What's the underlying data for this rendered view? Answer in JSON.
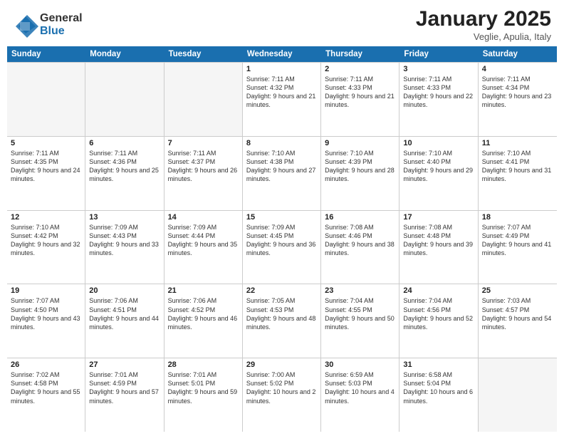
{
  "header": {
    "logo_general": "General",
    "logo_blue": "Blue",
    "month_title": "January 2025",
    "location": "Veglie, Apulia, Italy"
  },
  "weekdays": [
    "Sunday",
    "Monday",
    "Tuesday",
    "Wednesday",
    "Thursday",
    "Friday",
    "Saturday"
  ],
  "weeks": [
    [
      {
        "day": "",
        "info": ""
      },
      {
        "day": "",
        "info": ""
      },
      {
        "day": "",
        "info": ""
      },
      {
        "day": "1",
        "info": "Sunrise: 7:11 AM\nSunset: 4:32 PM\nDaylight: 9 hours and 21 minutes."
      },
      {
        "day": "2",
        "info": "Sunrise: 7:11 AM\nSunset: 4:33 PM\nDaylight: 9 hours and 21 minutes."
      },
      {
        "day": "3",
        "info": "Sunrise: 7:11 AM\nSunset: 4:33 PM\nDaylight: 9 hours and 22 minutes."
      },
      {
        "day": "4",
        "info": "Sunrise: 7:11 AM\nSunset: 4:34 PM\nDaylight: 9 hours and 23 minutes."
      }
    ],
    [
      {
        "day": "5",
        "info": "Sunrise: 7:11 AM\nSunset: 4:35 PM\nDaylight: 9 hours and 24 minutes."
      },
      {
        "day": "6",
        "info": "Sunrise: 7:11 AM\nSunset: 4:36 PM\nDaylight: 9 hours and 25 minutes."
      },
      {
        "day": "7",
        "info": "Sunrise: 7:11 AM\nSunset: 4:37 PM\nDaylight: 9 hours and 26 minutes."
      },
      {
        "day": "8",
        "info": "Sunrise: 7:10 AM\nSunset: 4:38 PM\nDaylight: 9 hours and 27 minutes."
      },
      {
        "day": "9",
        "info": "Sunrise: 7:10 AM\nSunset: 4:39 PM\nDaylight: 9 hours and 28 minutes."
      },
      {
        "day": "10",
        "info": "Sunrise: 7:10 AM\nSunset: 4:40 PM\nDaylight: 9 hours and 29 minutes."
      },
      {
        "day": "11",
        "info": "Sunrise: 7:10 AM\nSunset: 4:41 PM\nDaylight: 9 hours and 31 minutes."
      }
    ],
    [
      {
        "day": "12",
        "info": "Sunrise: 7:10 AM\nSunset: 4:42 PM\nDaylight: 9 hours and 32 minutes."
      },
      {
        "day": "13",
        "info": "Sunrise: 7:09 AM\nSunset: 4:43 PM\nDaylight: 9 hours and 33 minutes."
      },
      {
        "day": "14",
        "info": "Sunrise: 7:09 AM\nSunset: 4:44 PM\nDaylight: 9 hours and 35 minutes."
      },
      {
        "day": "15",
        "info": "Sunrise: 7:09 AM\nSunset: 4:45 PM\nDaylight: 9 hours and 36 minutes."
      },
      {
        "day": "16",
        "info": "Sunrise: 7:08 AM\nSunset: 4:46 PM\nDaylight: 9 hours and 38 minutes."
      },
      {
        "day": "17",
        "info": "Sunrise: 7:08 AM\nSunset: 4:48 PM\nDaylight: 9 hours and 39 minutes."
      },
      {
        "day": "18",
        "info": "Sunrise: 7:07 AM\nSunset: 4:49 PM\nDaylight: 9 hours and 41 minutes."
      }
    ],
    [
      {
        "day": "19",
        "info": "Sunrise: 7:07 AM\nSunset: 4:50 PM\nDaylight: 9 hours and 43 minutes."
      },
      {
        "day": "20",
        "info": "Sunrise: 7:06 AM\nSunset: 4:51 PM\nDaylight: 9 hours and 44 minutes."
      },
      {
        "day": "21",
        "info": "Sunrise: 7:06 AM\nSunset: 4:52 PM\nDaylight: 9 hours and 46 minutes."
      },
      {
        "day": "22",
        "info": "Sunrise: 7:05 AM\nSunset: 4:53 PM\nDaylight: 9 hours and 48 minutes."
      },
      {
        "day": "23",
        "info": "Sunrise: 7:04 AM\nSunset: 4:55 PM\nDaylight: 9 hours and 50 minutes."
      },
      {
        "day": "24",
        "info": "Sunrise: 7:04 AM\nSunset: 4:56 PM\nDaylight: 9 hours and 52 minutes."
      },
      {
        "day": "25",
        "info": "Sunrise: 7:03 AM\nSunset: 4:57 PM\nDaylight: 9 hours and 54 minutes."
      }
    ],
    [
      {
        "day": "26",
        "info": "Sunrise: 7:02 AM\nSunset: 4:58 PM\nDaylight: 9 hours and 55 minutes."
      },
      {
        "day": "27",
        "info": "Sunrise: 7:01 AM\nSunset: 4:59 PM\nDaylight: 9 hours and 57 minutes."
      },
      {
        "day": "28",
        "info": "Sunrise: 7:01 AM\nSunset: 5:01 PM\nDaylight: 9 hours and 59 minutes."
      },
      {
        "day": "29",
        "info": "Sunrise: 7:00 AM\nSunset: 5:02 PM\nDaylight: 10 hours and 2 minutes."
      },
      {
        "day": "30",
        "info": "Sunrise: 6:59 AM\nSunset: 5:03 PM\nDaylight: 10 hours and 4 minutes."
      },
      {
        "day": "31",
        "info": "Sunrise: 6:58 AM\nSunset: 5:04 PM\nDaylight: 10 hours and 6 minutes."
      },
      {
        "day": "",
        "info": ""
      }
    ]
  ]
}
